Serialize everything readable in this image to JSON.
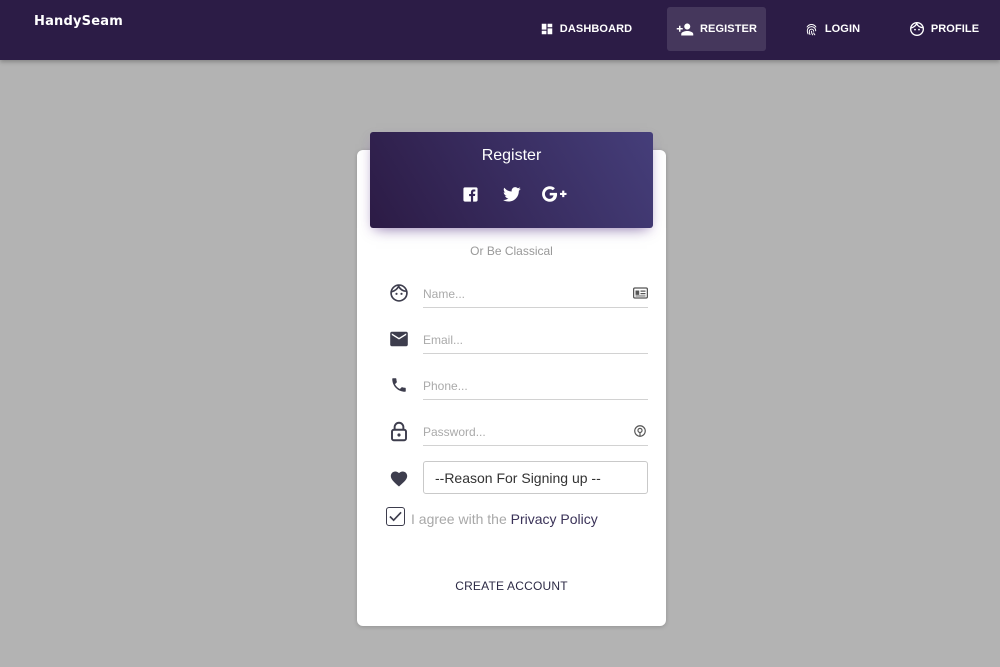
{
  "brand": "HandySeam",
  "nav": {
    "items": [
      {
        "label": "DASHBOARD",
        "icon": "dashboard-icon",
        "active": false
      },
      {
        "label": "REGISTER",
        "icon": "person-add-icon",
        "active": true
      },
      {
        "label": "LOGIN",
        "icon": "fingerprint-icon",
        "active": false
      },
      {
        "label": "PROFILE",
        "icon": "face-icon",
        "active": false
      }
    ]
  },
  "card": {
    "title": "Register",
    "social": [
      "facebook-icon",
      "twitter-icon",
      "google-plus-icon"
    ],
    "subtitle": "Or Be Classical",
    "fields": {
      "name": {
        "placeholder": "Name...",
        "icon": "face-icon",
        "trailing_icon": "id-card-icon"
      },
      "email": {
        "placeholder": "Email...",
        "icon": "mail-icon"
      },
      "phone": {
        "placeholder": "Phone...",
        "icon": "phone-icon"
      },
      "password": {
        "placeholder": "Password...",
        "icon": "lock-icon",
        "trailing_icon": "fingerprint-lock-icon"
      }
    },
    "reason": {
      "selected": "--Reason For Signing up --",
      "icon": "heart-icon"
    },
    "agree": {
      "prefix": "I agree with the ",
      "link": "Privacy Policy",
      "checked": true
    },
    "submit": "CREATE ACCOUNT"
  },
  "colors": {
    "navbar": "#2c1c46",
    "page_background": "#b3b3b3",
    "header_gradient_start": "#2c1b45",
    "header_gradient_end": "#453e7a",
    "icon": "#3d3d4d"
  }
}
